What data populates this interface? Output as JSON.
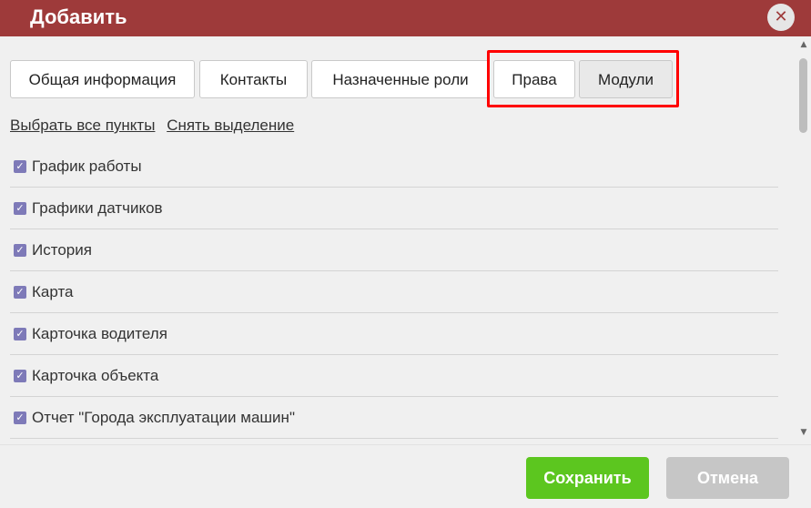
{
  "dialog": {
    "title": "Добавить",
    "close_symbol": "✕"
  },
  "tabs": [
    {
      "label": "Общая информация"
    },
    {
      "label": "Контакты"
    },
    {
      "label": "Назначенные роли"
    },
    {
      "label": "Права"
    },
    {
      "label": "Модули",
      "active": true
    }
  ],
  "selection": {
    "select_all": "Выбрать все пункты",
    "deselect": "Снять выделение"
  },
  "modules": [
    {
      "label": "График работы",
      "checked": true
    },
    {
      "label": "Графики датчиков",
      "checked": true
    },
    {
      "label": "История",
      "checked": true
    },
    {
      "label": "Карта",
      "checked": true
    },
    {
      "label": "Карточка водителя",
      "checked": true
    },
    {
      "label": "Карточка объекта",
      "checked": true
    },
    {
      "label": "Отчет \"Города эксплуатации машин\"",
      "checked": true
    }
  ],
  "icons": {
    "checkbox": "✓",
    "scroll_up": "▲",
    "scroll_down": "▼"
  },
  "footer": {
    "save_label": "Сохранить",
    "cancel_label": "Отмена"
  },
  "colors": {
    "titlebar": "#9e3a3a",
    "save": "#5cc61f",
    "cancel": "#c6c6c6",
    "checkbox": "#7e7ab8",
    "highlight": "#ff0000"
  }
}
